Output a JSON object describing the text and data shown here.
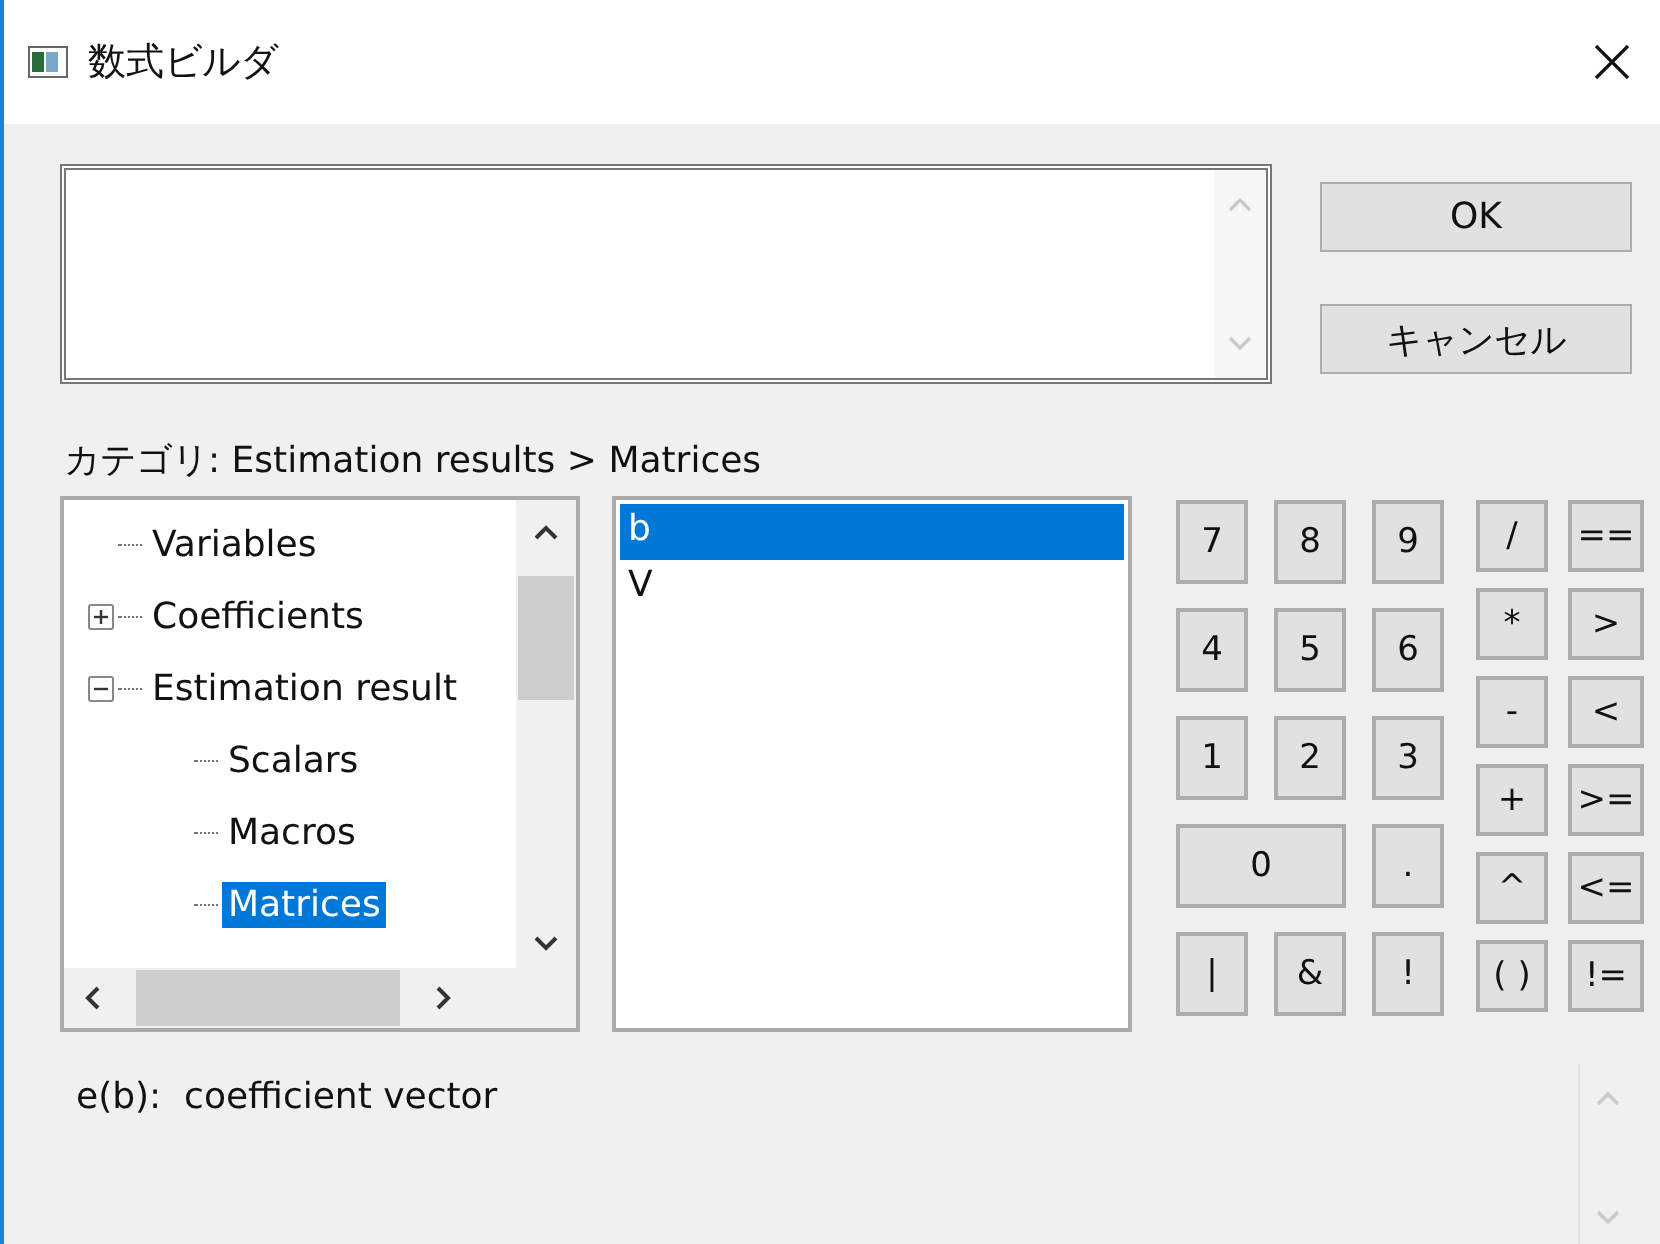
{
  "window": {
    "title": "数式ビルダ"
  },
  "buttons": [
    {
      "label": "OK"
    },
    {
      "label": "キャンセル"
    }
  ],
  "category_label": "カテゴリ: Estimation results > Matrices",
  "tree": {
    "items": [
      {
        "label": "Variables",
        "selected": false
      },
      {
        "label": "Coefficients",
        "selected": false,
        "expanded": false
      },
      {
        "label": "Estimation result",
        "selected": false,
        "expanded": true,
        "children": [
          {
            "label": "Scalars",
            "selected": false
          },
          {
            "label": "Macros",
            "selected": false
          },
          {
            "label": "Matrices",
            "selected": true
          }
        ]
      }
    ]
  },
  "list": {
    "items": [
      {
        "label": "b",
        "selected": true
      },
      {
        "label": "V",
        "selected": false
      }
    ]
  },
  "keypad": {
    "digits": [
      {
        "label": "7",
        "wide": false
      },
      {
        "label": "8",
        "wide": false
      },
      {
        "label": "9",
        "wide": false
      },
      {
        "label": "4",
        "wide": false
      },
      {
        "label": "5",
        "wide": false
      },
      {
        "label": "6",
        "wide": false
      },
      {
        "label": "1",
        "wide": false
      },
      {
        "label": "2",
        "wide": false
      },
      {
        "label": "3",
        "wide": false
      },
      {
        "label": "0",
        "wide": true
      },
      {
        "label": ".",
        "wide": false
      },
      {
        "label": "|",
        "wide": false
      },
      {
        "label": "&",
        "wide": false
      },
      {
        "label": "!",
        "wide": false
      }
    ],
    "operators": [
      "/",
      "==",
      "*",
      ">",
      "-",
      "<",
      "+",
      ">=",
      "^",
      "<=",
      "( )",
      "!="
    ]
  },
  "description": "e(b):  coefficient vector"
}
